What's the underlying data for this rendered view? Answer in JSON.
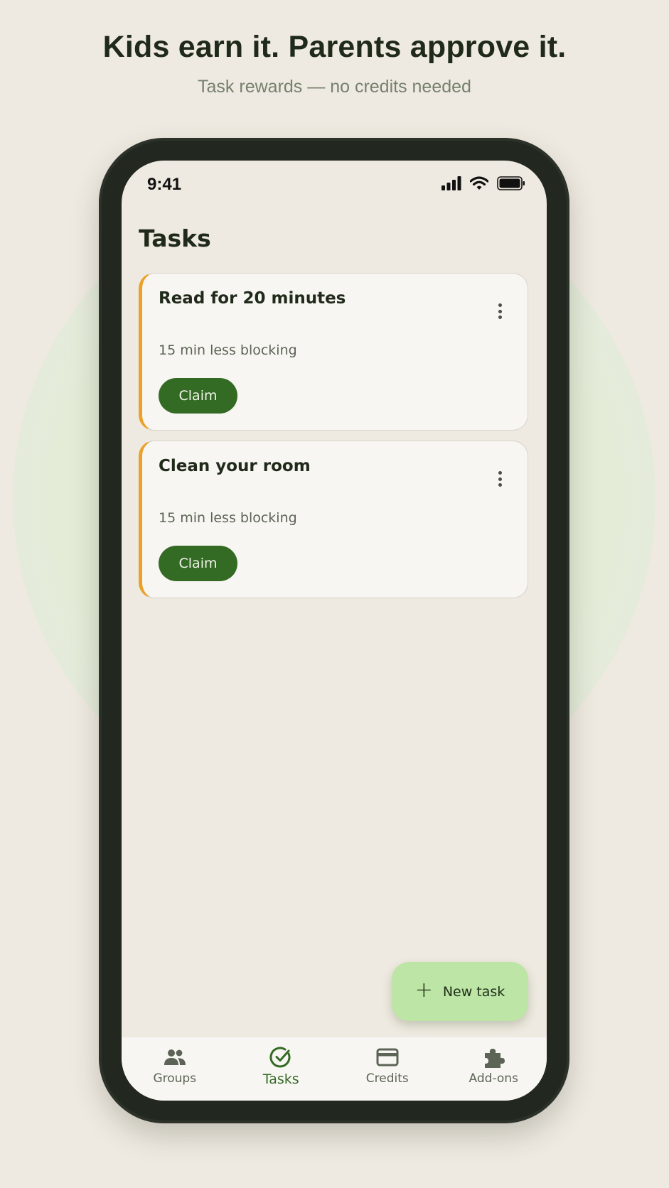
{
  "promo": {
    "headline": "Kids earn it. Parents approve it.",
    "subline": "Task rewards — no credits needed"
  },
  "status_bar": {
    "time": "9:41",
    "icons": [
      "cellular-signal-icon",
      "wifi-icon",
      "battery-icon"
    ]
  },
  "page": {
    "title": "Tasks"
  },
  "tasks": [
    {
      "title": "Read for 20 minutes",
      "reward": "15 min less blocking",
      "action": "Claim"
    },
    {
      "title": "Clean your room",
      "reward": "15 min less blocking",
      "action": "Claim"
    }
  ],
  "fab": {
    "label": "New task",
    "icon": "plus-icon"
  },
  "nav": {
    "items": [
      {
        "label": "Groups",
        "icon": "groups-icon",
        "active": false
      },
      {
        "label": "Tasks",
        "icon": "check-circle-icon",
        "active": true
      },
      {
        "label": "Credits",
        "icon": "credit-card-icon",
        "active": false
      },
      {
        "label": "Add-ons",
        "icon": "puzzle-icon",
        "active": false
      }
    ]
  },
  "colors": {
    "background": "#efeae1",
    "primary": "#346b24",
    "fab": "#bde5a6",
    "card_accent": "#eaa12a",
    "text_dark": "#1f2a1a"
  }
}
